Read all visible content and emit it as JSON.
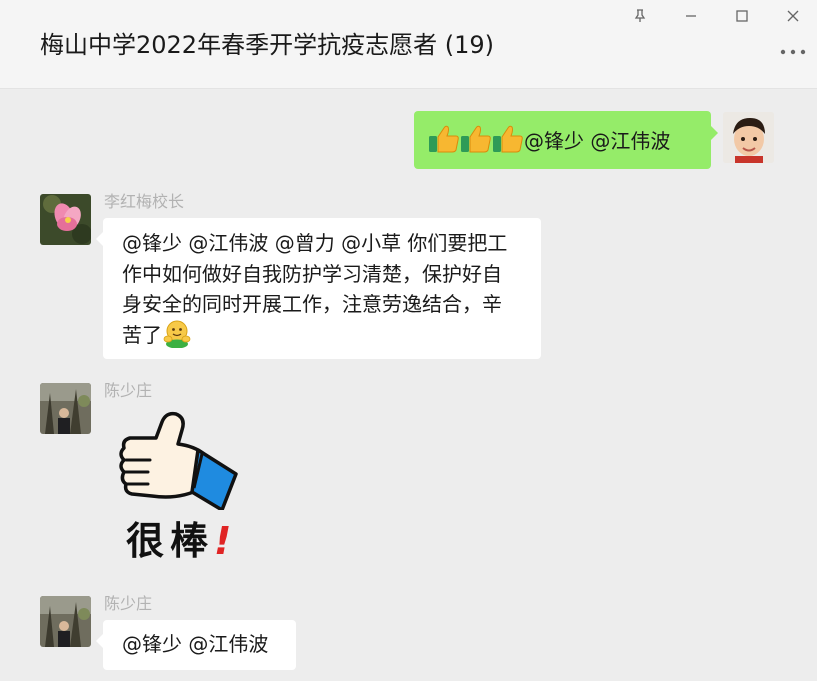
{
  "window": {
    "title": "梅山中学2022年春季开学抗疫志愿者 (19)",
    "buttons": {
      "pin_icon": "pin-icon",
      "minimize_icon": "minimize-icon",
      "maximize_icon": "maximize-icon",
      "close_icon": "close-icon",
      "more_icon": "more-icon"
    }
  },
  "colors": {
    "self_bubble": "#95ec69",
    "other_bubble": "#ffffff",
    "background": "#ededed",
    "sender_name": "#b2b2b2"
  },
  "messages": [
    {
      "direction": "outgoing",
      "emoji_count": 3,
      "emoji": "thumbs-up-emoji",
      "text": "@锋少 @江伟波"
    },
    {
      "direction": "incoming",
      "sender": "李红梅校长",
      "lines": [
        "@锋少 @江伟波 @曾力 @小草 你们要把工",
        "作中如何做好自我防护学习清楚，保护好自",
        "身安全的同时开展工作，注意劳逸结合，辛",
        "苦了"
      ],
      "trailing_emoji": "hug-face-emoji"
    },
    {
      "direction": "incoming",
      "sender": "陈少庄",
      "sticker": {
        "icon": "thumbs-up-sticker",
        "text": "很棒",
        "mark": "!"
      }
    },
    {
      "direction": "incoming",
      "sender": "陈少庄",
      "text": "@锋少 @江伟波"
    }
  ]
}
